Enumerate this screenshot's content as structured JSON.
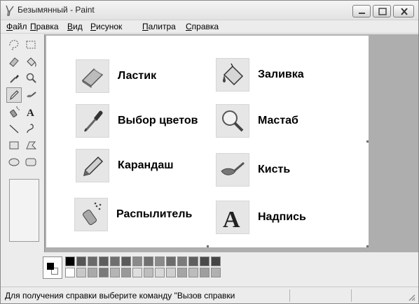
{
  "window": {
    "title": "Безымянный - Paint"
  },
  "menubar": {
    "items": [
      {
        "first": "Ф",
        "rest": "айл"
      },
      {
        "first": "П",
        "rest": "равка"
      },
      {
        "first": "В",
        "rest": "ид"
      },
      {
        "first": "Р",
        "rest": "исунок"
      },
      {
        "first": "П",
        "rest": "алитра"
      },
      {
        "first": "С",
        "rest": "правка"
      }
    ]
  },
  "toolbox": {
    "tools": [
      "free-select-icon",
      "rect-select-icon",
      "eraser-icon",
      "fill-icon",
      "color-picker-icon",
      "magnifier-icon",
      "pencil-icon",
      "brush-icon",
      "airbrush-icon",
      "text-icon",
      "line-icon",
      "curve-icon",
      "rectangle-icon",
      "polygon-icon",
      "ellipse-icon",
      "rounded-rect-icon"
    ],
    "selected": "pencil-icon"
  },
  "canvas": {
    "cards": [
      {
        "icon": "eraser-icon",
        "label": "Ластик"
      },
      {
        "icon": "fill-icon",
        "label": "Заливка"
      },
      {
        "icon": "color-picker-icon",
        "label": "Выбор цветов"
      },
      {
        "icon": "magnifier-icon",
        "label": "Мастаб"
      },
      {
        "icon": "pencil-icon",
        "label": "Карандаш"
      },
      {
        "icon": "brush-icon",
        "label": "Кисть"
      },
      {
        "icon": "airbrush-icon",
        "label": "Распылитель"
      },
      {
        "icon": "text-icon",
        "label": "Надпись"
      }
    ]
  },
  "palette": {
    "foreground": "#000000",
    "background": "#ffffff",
    "top_row": [
      "#000000",
      "#555555",
      "#6a6a6a",
      "#5d5d5d",
      "#6f6f6f",
      "#5a5a5a",
      "#8a8a8a",
      "#707070",
      "#8b8b8b",
      "#6d6d6d",
      "#7b7b7b",
      "#5f5f5f",
      "#4a4a4a",
      "#444444"
    ],
    "bottom_row": [
      "#ffffff",
      "#c8c8c8",
      "#a9a9a9",
      "#7a7a7a",
      "#b5b5b5",
      "#999999",
      "#dedede",
      "#bdbdbd",
      "#d7d7d7",
      "#cfcfcf",
      "#a5a5a5",
      "#bcbcbc",
      "#9e9e9e",
      "#b0b0b0"
    ]
  },
  "statusbar": {
    "text": "Для получения справки выберите команду \"Вызов справки"
  }
}
